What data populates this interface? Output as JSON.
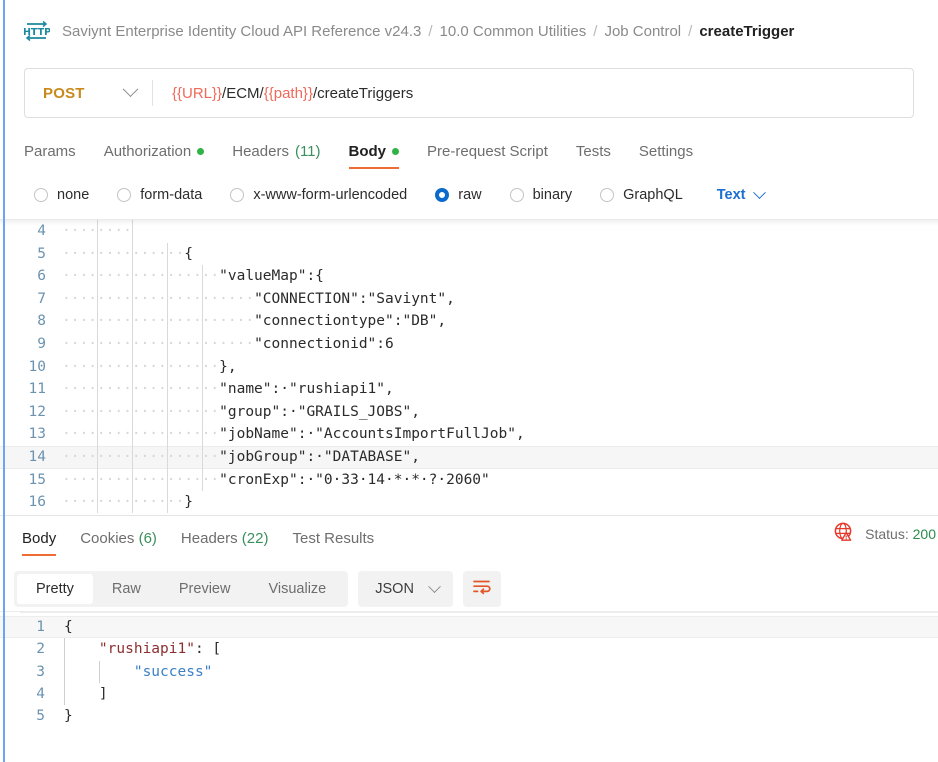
{
  "header": {
    "icon": "http-protocol-icon",
    "breadcrumb": [
      {
        "label": "Saviynt Enterprise Identity Cloud API Reference v24.3",
        "active": false
      },
      {
        "label": "10.0 Common Utilities",
        "active": false
      },
      {
        "label": "Job Control",
        "active": false
      },
      {
        "label": "createTrigger",
        "active": true
      }
    ],
    "separator": "/"
  },
  "request": {
    "method": "POST",
    "method_color": "#c98a1b",
    "url_parts": [
      {
        "text": "{{URL}}",
        "variable": true
      },
      {
        "text": "/ECM/",
        "variable": false
      },
      {
        "text": "{{path}}",
        "variable": true
      },
      {
        "text": "/createTriggers",
        "variable": false
      }
    ],
    "url_full": "{{URL}}/ECM/{{path}}/createTriggers",
    "tabs": [
      {
        "label": "Params",
        "active": false,
        "dot": false,
        "count": ""
      },
      {
        "label": "Authorization",
        "active": false,
        "dot": true,
        "count": ""
      },
      {
        "label": "Headers",
        "active": false,
        "dot": false,
        "count": "(11)"
      },
      {
        "label": "Body",
        "active": true,
        "dot": true,
        "count": ""
      },
      {
        "label": "Pre-request Script",
        "active": false,
        "dot": false,
        "count": ""
      },
      {
        "label": "Tests",
        "active": false,
        "dot": false,
        "count": ""
      },
      {
        "label": "Settings",
        "active": false,
        "dot": false,
        "count": ""
      }
    ],
    "body_types": [
      {
        "label": "none",
        "checked": false
      },
      {
        "label": "form-data",
        "checked": false
      },
      {
        "label": "x-www-form-urlencoded",
        "checked": false
      },
      {
        "label": "raw",
        "checked": true
      },
      {
        "label": "binary",
        "checked": false
      },
      {
        "label": "GraphQL",
        "checked": false
      }
    ],
    "raw_format": "Text",
    "editor_lines": [
      {
        "number": "4",
        "content": "",
        "indent_dots": 8,
        "highlight": false
      },
      {
        "number": "5",
        "content": "{",
        "indent_dots": 14,
        "highlight": false
      },
      {
        "number": "6",
        "content": "\"valueMap\":{",
        "indent_dots": 18,
        "highlight": false
      },
      {
        "number": "7",
        "content": "\"CONNECTION\":\"Saviynt\",",
        "indent_dots": 22,
        "highlight": false
      },
      {
        "number": "8",
        "content": "\"connectiontype\":\"DB\",",
        "indent_dots": 22,
        "highlight": false
      },
      {
        "number": "9",
        "content": "\"connectionid\":6",
        "indent_dots": 22,
        "highlight": false
      },
      {
        "number": "10",
        "content": "},",
        "indent_dots": 18,
        "highlight": false
      },
      {
        "number": "11",
        "content": "\"name\": \"rushiapi1\",",
        "indent_dots": 18,
        "highlight": false
      },
      {
        "number": "12",
        "content": "\"group\": \"GRAILS_JOBS\",",
        "indent_dots": 18,
        "highlight": false
      },
      {
        "number": "13",
        "content": "\"jobName\": \"AccountsImportFullJob\",",
        "indent_dots": 18,
        "highlight": false
      },
      {
        "number": "14",
        "content": "\"jobGroup\": \"DATABASE\",",
        "indent_dots": 18,
        "highlight": true
      },
      {
        "number": "15",
        "content": "\"cronExp\": \"0 33 14 * * ? 2060\"",
        "indent_dots": 18,
        "highlight": false
      },
      {
        "number": "16",
        "content": "}",
        "indent_dots": 14,
        "highlight": false
      }
    ]
  },
  "response": {
    "tabs": [
      {
        "label": "Body",
        "active": true,
        "count": ""
      },
      {
        "label": "Cookies",
        "active": false,
        "count": "(6)"
      },
      {
        "label": "Headers",
        "active": false,
        "count": "(22)"
      },
      {
        "label": "Test Results",
        "active": false,
        "count": ""
      }
    ],
    "warning_icon": "globe-warning-icon",
    "status_label": "Status:",
    "status_code": "200",
    "status_color": "#2b8a4b",
    "view_modes": [
      {
        "label": "Pretty",
        "active": true
      },
      {
        "label": "Raw",
        "active": false
      },
      {
        "label": "Preview",
        "active": false
      },
      {
        "label": "Visualize",
        "active": false
      }
    ],
    "format": "JSON",
    "wrap_icon": "word-wrap-icon",
    "body_lines": [
      {
        "number": "1",
        "highlight": true,
        "tokens": [
          {
            "t": "{",
            "c": "pun"
          }
        ]
      },
      {
        "number": "2",
        "highlight": false,
        "tokens": [
          {
            "t": "    ",
            "c": "pun"
          },
          {
            "t": "\"rushiapi1\"",
            "c": "key"
          },
          {
            "t": ": [",
            "c": "pun"
          }
        ]
      },
      {
        "number": "3",
        "highlight": false,
        "tokens": [
          {
            "t": "        ",
            "c": "pun"
          },
          {
            "t": "\"success\"",
            "c": "str"
          }
        ]
      },
      {
        "number": "4",
        "highlight": false,
        "tokens": [
          {
            "t": "    ]",
            "c": "pun"
          }
        ]
      },
      {
        "number": "5",
        "highlight": false,
        "tokens": [
          {
            "t": "}",
            "c": "pun"
          }
        ]
      }
    ]
  }
}
